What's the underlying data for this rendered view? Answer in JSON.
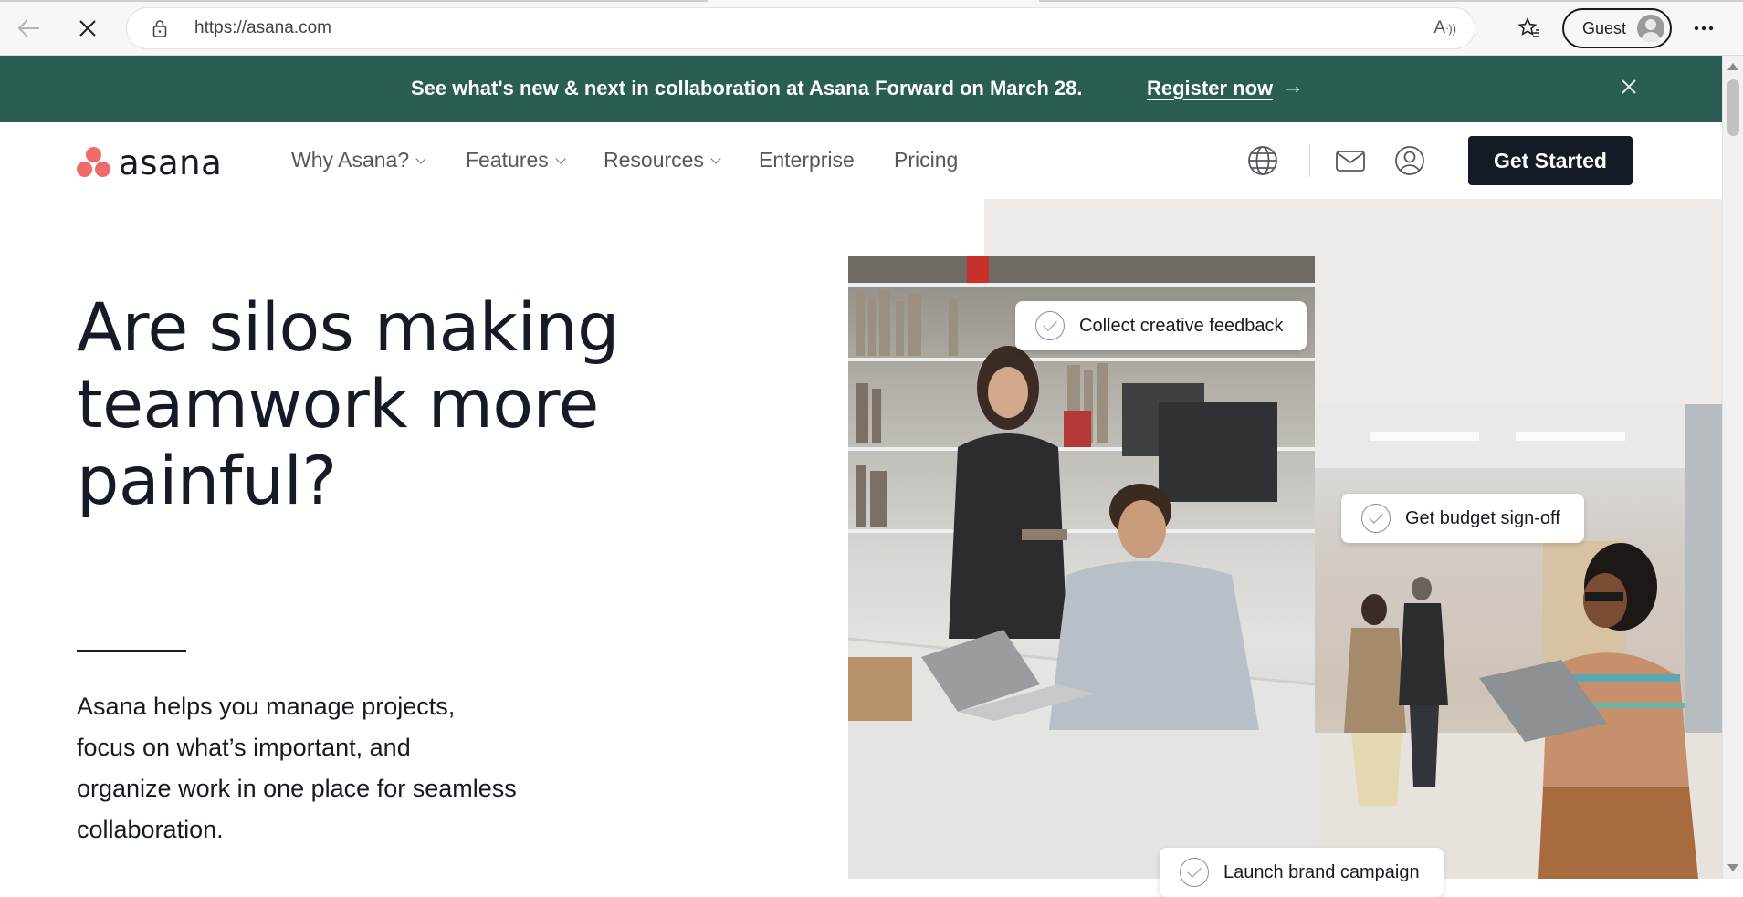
{
  "browser": {
    "url": "https://asana.com",
    "profile_label": "Guest"
  },
  "banner": {
    "text": "See what's new & next in collaboration at Asana Forward on March 28.",
    "link_label": "Register now",
    "link_arrow": "→"
  },
  "nav": {
    "logo_text": "asana",
    "items": [
      {
        "label": "Why Asana?",
        "has_dropdown": true
      },
      {
        "label": "Features",
        "has_dropdown": true
      },
      {
        "label": "Resources",
        "has_dropdown": true
      },
      {
        "label": "Enterprise",
        "has_dropdown": false
      },
      {
        "label": "Pricing",
        "has_dropdown": false
      }
    ],
    "icons": [
      "globe-icon",
      "mail-icon",
      "account-icon"
    ],
    "cta_label": "Get Started"
  },
  "hero": {
    "headline_lines": [
      "Are silos making",
      "teamwork more",
      "painful?"
    ],
    "subtext_lines": [
      "Asana helps you manage projects,",
      "focus on what’s important, and",
      "organize work in one place for seamless",
      "collaboration."
    ],
    "tasks": [
      "Collect creative feedback",
      "Get budget sign-off",
      "Launch brand campaign"
    ]
  },
  "colors": {
    "banner_bg": "#2a5e52",
    "cta_bg": "#151b26",
    "logo_coral": "#f06a6a",
    "hero_panel_bg": "#edeae8"
  }
}
